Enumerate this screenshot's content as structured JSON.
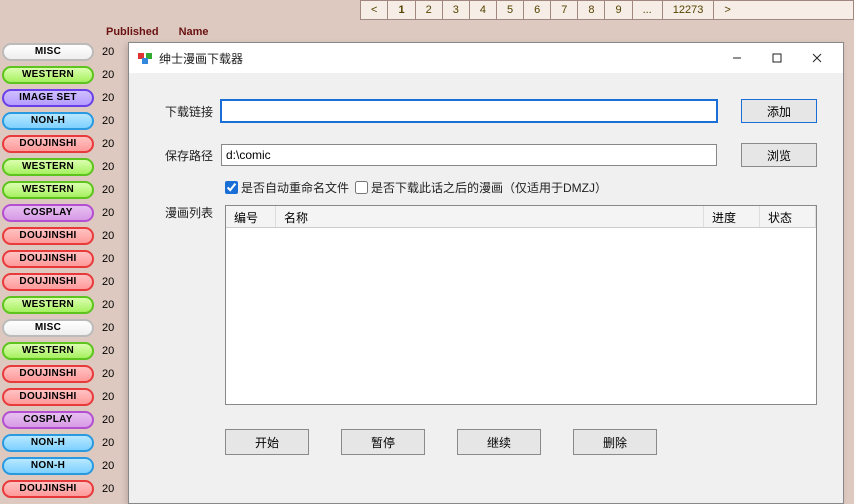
{
  "pagination": {
    "prev": "<",
    "next": ">",
    "ellipsis": "...",
    "pages": [
      "1",
      "2",
      "3",
      "4",
      "5",
      "6",
      "7",
      "8",
      "9"
    ],
    "last": "12273",
    "current": "1"
  },
  "header": {
    "published": "Published",
    "name": "Name"
  },
  "sidebar": [
    {
      "cat": "MISC",
      "cls": "p-misc",
      "year": "20"
    },
    {
      "cat": "WESTERN",
      "cls": "p-western",
      "year": "20"
    },
    {
      "cat": "IMAGE SET",
      "cls": "p-imageset",
      "year": "20"
    },
    {
      "cat": "NON-H",
      "cls": "p-nonh",
      "year": "20"
    },
    {
      "cat": "DOUJINSHI",
      "cls": "p-doujin",
      "year": "20"
    },
    {
      "cat": "WESTERN",
      "cls": "p-western",
      "year": "20"
    },
    {
      "cat": "WESTERN",
      "cls": "p-western",
      "year": "20"
    },
    {
      "cat": "COSPLAY",
      "cls": "p-cosplay",
      "year": "20"
    },
    {
      "cat": "DOUJINSHI",
      "cls": "p-doujin",
      "year": "20"
    },
    {
      "cat": "DOUJINSHI",
      "cls": "p-doujin",
      "year": "20"
    },
    {
      "cat": "DOUJINSHI",
      "cls": "p-doujin",
      "year": "20"
    },
    {
      "cat": "WESTERN",
      "cls": "p-western",
      "year": "20"
    },
    {
      "cat": "MISC",
      "cls": "p-misc",
      "year": "20"
    },
    {
      "cat": "WESTERN",
      "cls": "p-western",
      "year": "20"
    },
    {
      "cat": "DOUJINSHI",
      "cls": "p-doujin",
      "year": "20"
    },
    {
      "cat": "DOUJINSHI",
      "cls": "p-doujin",
      "year": "20"
    },
    {
      "cat": "COSPLAY",
      "cls": "p-cosplay",
      "year": "20"
    },
    {
      "cat": "NON-H",
      "cls": "p-nonh",
      "year": "20"
    },
    {
      "cat": "NON-H",
      "cls": "p-nonh",
      "year": "20"
    },
    {
      "cat": "DOUJINSHI",
      "cls": "p-doujin",
      "year": "20"
    }
  ],
  "dialog": {
    "title": "绅士漫画下载器",
    "url_label": "下载链接",
    "url_value": "",
    "path_label": "保存路径",
    "path_value": "d:\\comic",
    "add": "添加",
    "browse": "浏览",
    "chk_rename": "是否自动重命名文件",
    "chk_rename_checked": true,
    "chk_next": "是否下载此话之后的漫画（仅适用于DMZJ）",
    "chk_next_checked": false,
    "list_label": "漫画列表",
    "cols": {
      "num": "编号",
      "name": "名称",
      "progress": "进度",
      "status": "状态"
    },
    "btns": {
      "start": "开始",
      "pause": "暂停",
      "resume": "继续",
      "delete": "删除"
    }
  }
}
